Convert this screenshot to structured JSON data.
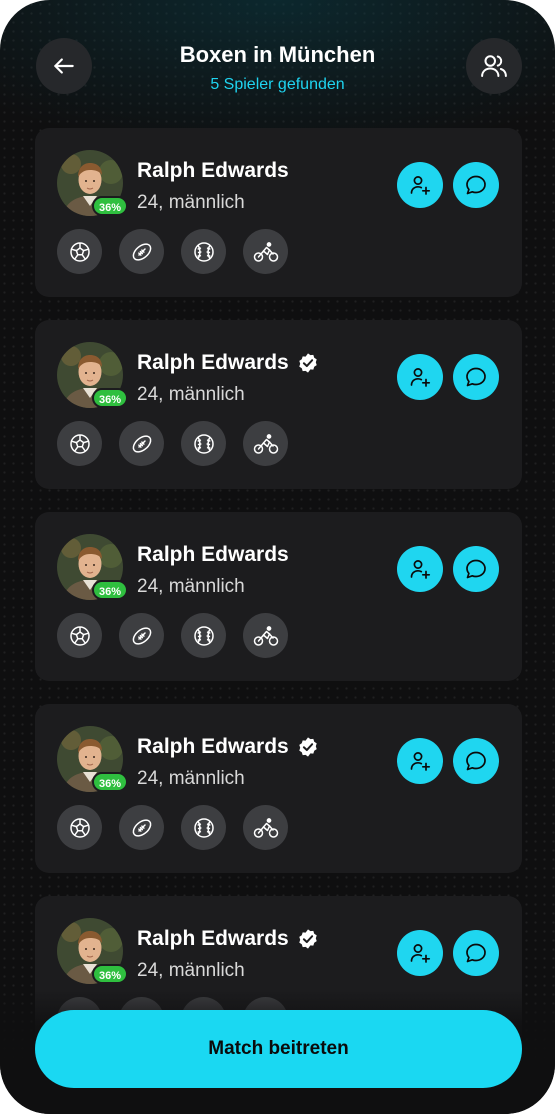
{
  "header": {
    "title": "Boxen in München",
    "subtitle": "5 Spieler gefunden",
    "back_icon": "arrow-left-icon",
    "players_icon": "users-icon"
  },
  "players": [
    {
      "name": "Ralph Edwards",
      "info": "24, männlich",
      "match_percent": "36%",
      "verified": false,
      "sports": [
        "soccer-ball-icon",
        "american-football-icon",
        "baseball-icon",
        "cycling-icon"
      ]
    },
    {
      "name": "Ralph Edwards",
      "info": "24, männlich",
      "match_percent": "36%",
      "verified": true,
      "sports": [
        "soccer-ball-icon",
        "american-football-icon",
        "baseball-icon",
        "cycling-icon"
      ]
    },
    {
      "name": "Ralph Edwards",
      "info": "24, männlich",
      "match_percent": "36%",
      "verified": false,
      "sports": [
        "soccer-ball-icon",
        "american-football-icon",
        "baseball-icon",
        "cycling-icon"
      ]
    },
    {
      "name": "Ralph Edwards",
      "info": "24, männlich",
      "match_percent": "36%",
      "verified": true,
      "sports": [
        "soccer-ball-icon",
        "american-football-icon",
        "baseball-icon",
        "cycling-icon"
      ]
    },
    {
      "name": "Ralph Edwards",
      "info": "24, männlich",
      "match_percent": "36%",
      "verified": true,
      "sports": [
        "soccer-ball-icon",
        "american-football-icon",
        "baseball-icon",
        "cycling-icon"
      ]
    }
  ],
  "join_button": {
    "label": "Match beitreten"
  },
  "colors": {
    "accent": "#1fd6f0",
    "card": "#1c1c1e",
    "badge": "#2fbf3f",
    "background": "#0f0f10"
  }
}
